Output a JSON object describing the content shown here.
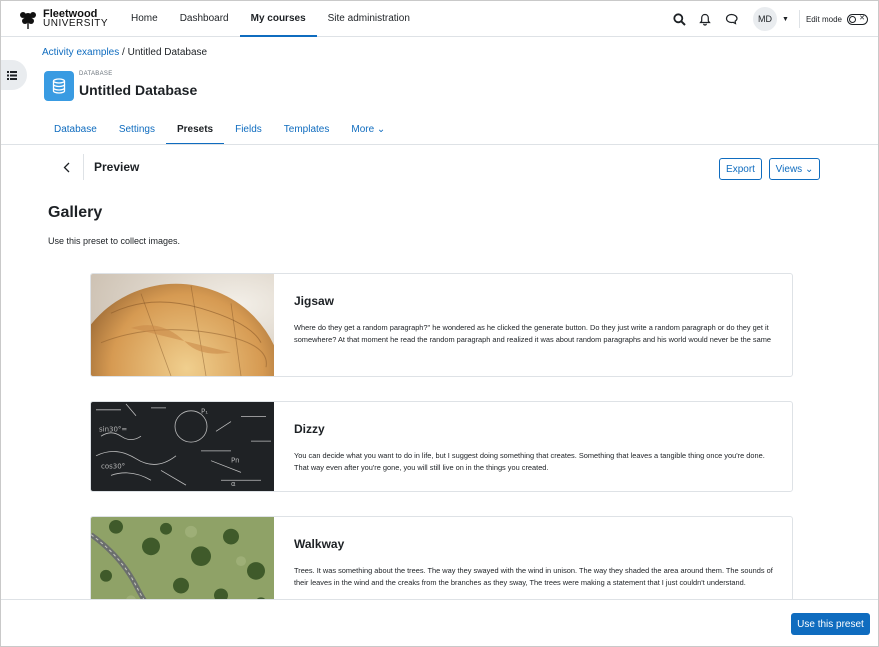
{
  "brand": {
    "line1": "Fleetwood",
    "line2": "UNIVERSITY"
  },
  "nav": {
    "items": [
      {
        "label": "Home"
      },
      {
        "label": "Dashboard"
      },
      {
        "label": "My courses"
      },
      {
        "label": "Site administration"
      }
    ],
    "active_index": 2,
    "user_initials": "MD",
    "edit_mode_label": "Edit mode"
  },
  "breadcrumb": {
    "parent": "Activity examples",
    "separator": " / ",
    "current": "Untitled Database"
  },
  "header": {
    "kicker": "DATABASE",
    "title": "Untitled Database"
  },
  "tabs": [
    {
      "label": "Database"
    },
    {
      "label": "Settings"
    },
    {
      "label": "Presets"
    },
    {
      "label": "Fields"
    },
    {
      "label": "Templates"
    },
    {
      "label": "More ⌄"
    }
  ],
  "preview": {
    "title": "Preview",
    "export_label": "Export",
    "views_label": "Views ⌄"
  },
  "gallery": {
    "title": "Gallery",
    "description": "Use this preset to collect images."
  },
  "cards": [
    {
      "title": "Jigsaw",
      "image": "globe-photo",
      "text": "Where do they get a random paragraph?\" he wondered as he clicked the generate button. Do they just write a random paragraph or do they get it somewhere? At that moment he read the random paragraph and realized it was about random paragraphs and his world would never be the same"
    },
    {
      "title": "Dizzy",
      "image": "chalkboard-photo",
      "text": "You can decide what you want to do in life, but I suggest doing something that creates. Something that leaves a tangible thing once you're done. That way even after you're gone, you will still live on in the things you created."
    },
    {
      "title": "Walkway",
      "image": "aerial-trees-photo",
      "text": "Trees. It was something about the trees. The way they swayed with the wind in unison. The way they shaded the area around them. The sounds of their leaves in the wind and the creaks from the branches as they sway, The trees were making a statement that I just couldn't understand."
    }
  ],
  "footer": {
    "use_preset_label": "Use this preset"
  },
  "colors": {
    "primary": "#0f6cbf",
    "db_icon_bg": "#399be2",
    "border": "#dee2e6"
  }
}
